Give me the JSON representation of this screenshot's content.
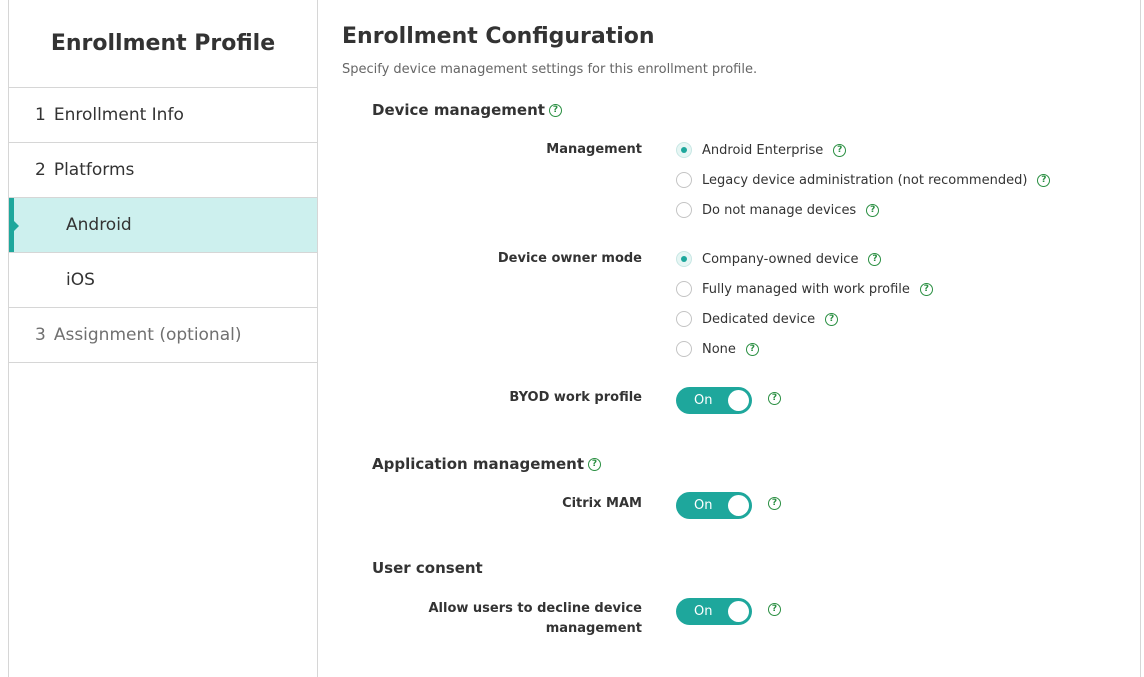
{
  "sidebar": {
    "title": "Enrollment Profile",
    "items": [
      {
        "num": "1",
        "label": "Enrollment Info"
      },
      {
        "num": "2",
        "label": "Platforms"
      },
      {
        "num": "",
        "label": "Android"
      },
      {
        "num": "",
        "label": "iOS"
      },
      {
        "num": "3",
        "label": "Assignment (optional)"
      }
    ]
  },
  "main": {
    "title": "Enrollment Configuration",
    "subtitle": "Specify device management settings for this enrollment profile.",
    "device_management": {
      "heading": "Device management",
      "management": {
        "label": "Management",
        "options": [
          "Android Enterprise",
          "Legacy device administration (not recommended)",
          "Do not manage devices"
        ],
        "selected": "Android Enterprise"
      },
      "owner_mode": {
        "label": "Device owner mode",
        "options": [
          "Company-owned device",
          "Fully managed with work profile",
          "Dedicated device",
          "None"
        ],
        "selected": "Company-owned device"
      },
      "byod": {
        "label": "BYOD work profile",
        "state": "On"
      }
    },
    "app_management": {
      "heading": "Application management",
      "citrix_mam": {
        "label": "Citrix MAM",
        "state": "On"
      }
    },
    "user_consent": {
      "heading": "User consent",
      "allow_decline": {
        "label": "Allow users to decline device management",
        "state": "On"
      }
    }
  },
  "help_glyph": "?",
  "colors": {
    "accent": "#1ea79c",
    "active_bg": "#cdf0ee",
    "help": "#2a8f42"
  }
}
